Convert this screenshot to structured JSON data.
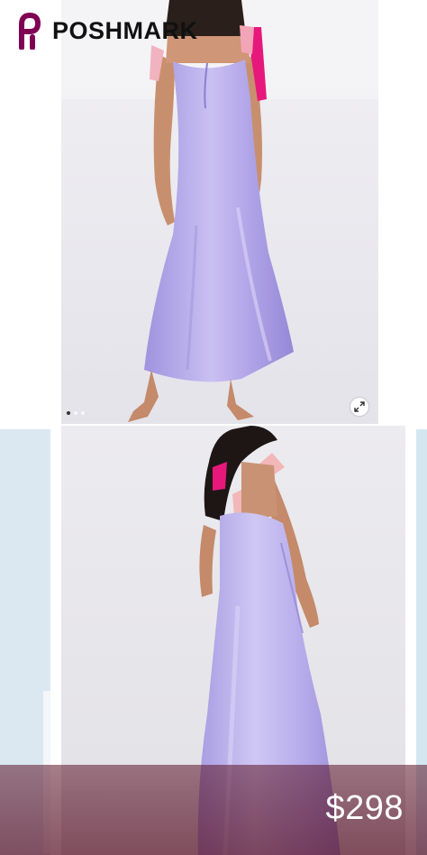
{
  "brand": {
    "name": "POSHMARK",
    "color": "#7f0353"
  },
  "listing": {
    "price": "$298",
    "dress_color": "#b3a6e6",
    "image_count": 3,
    "active_image": 1
  },
  "icons": {
    "logo": "poshmark-logo-icon",
    "expand": "expand-icon"
  }
}
